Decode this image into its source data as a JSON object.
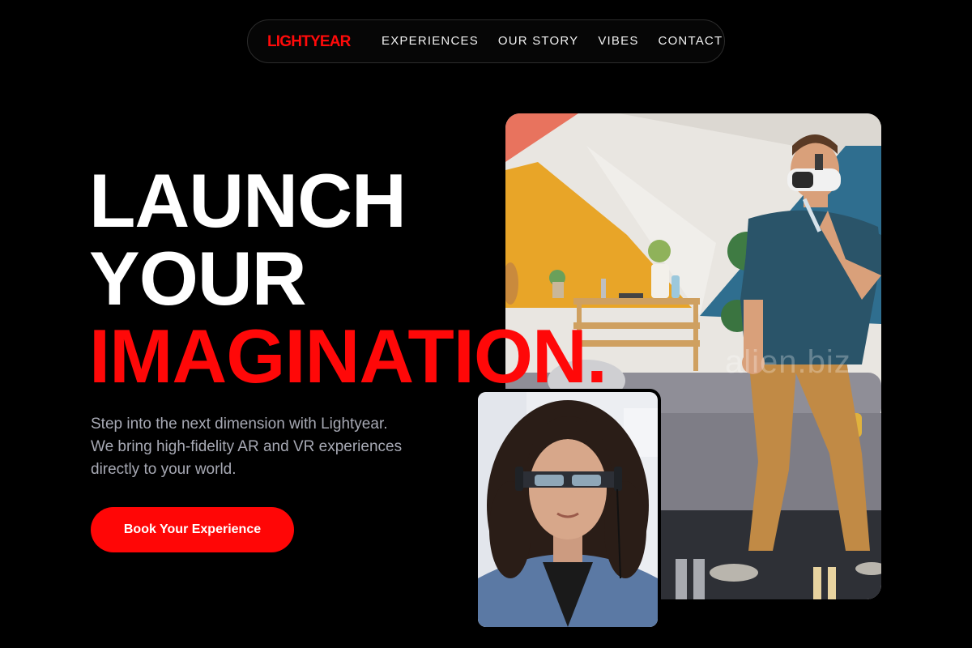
{
  "nav": {
    "logo": "LIGHTYEAR",
    "links": [
      "EXPERIENCES",
      "OUR STORY",
      "VIBES",
      "CONTACT"
    ]
  },
  "hero": {
    "headline": [
      "LAUNCH",
      "YOUR",
      "IMAGINATION."
    ],
    "subtext": [
      "Step into the next dimension with Lightyear.",
      "We bring high-fidelity AR and VR experiences",
      "directly to your world."
    ],
    "cta_label": "Book Your Experience"
  },
  "images": {
    "main_watermark": "alien.biz"
  },
  "colors": {
    "brand_red": "#ff0808",
    "background": "#000000",
    "subtext": "#a7a9b4"
  }
}
